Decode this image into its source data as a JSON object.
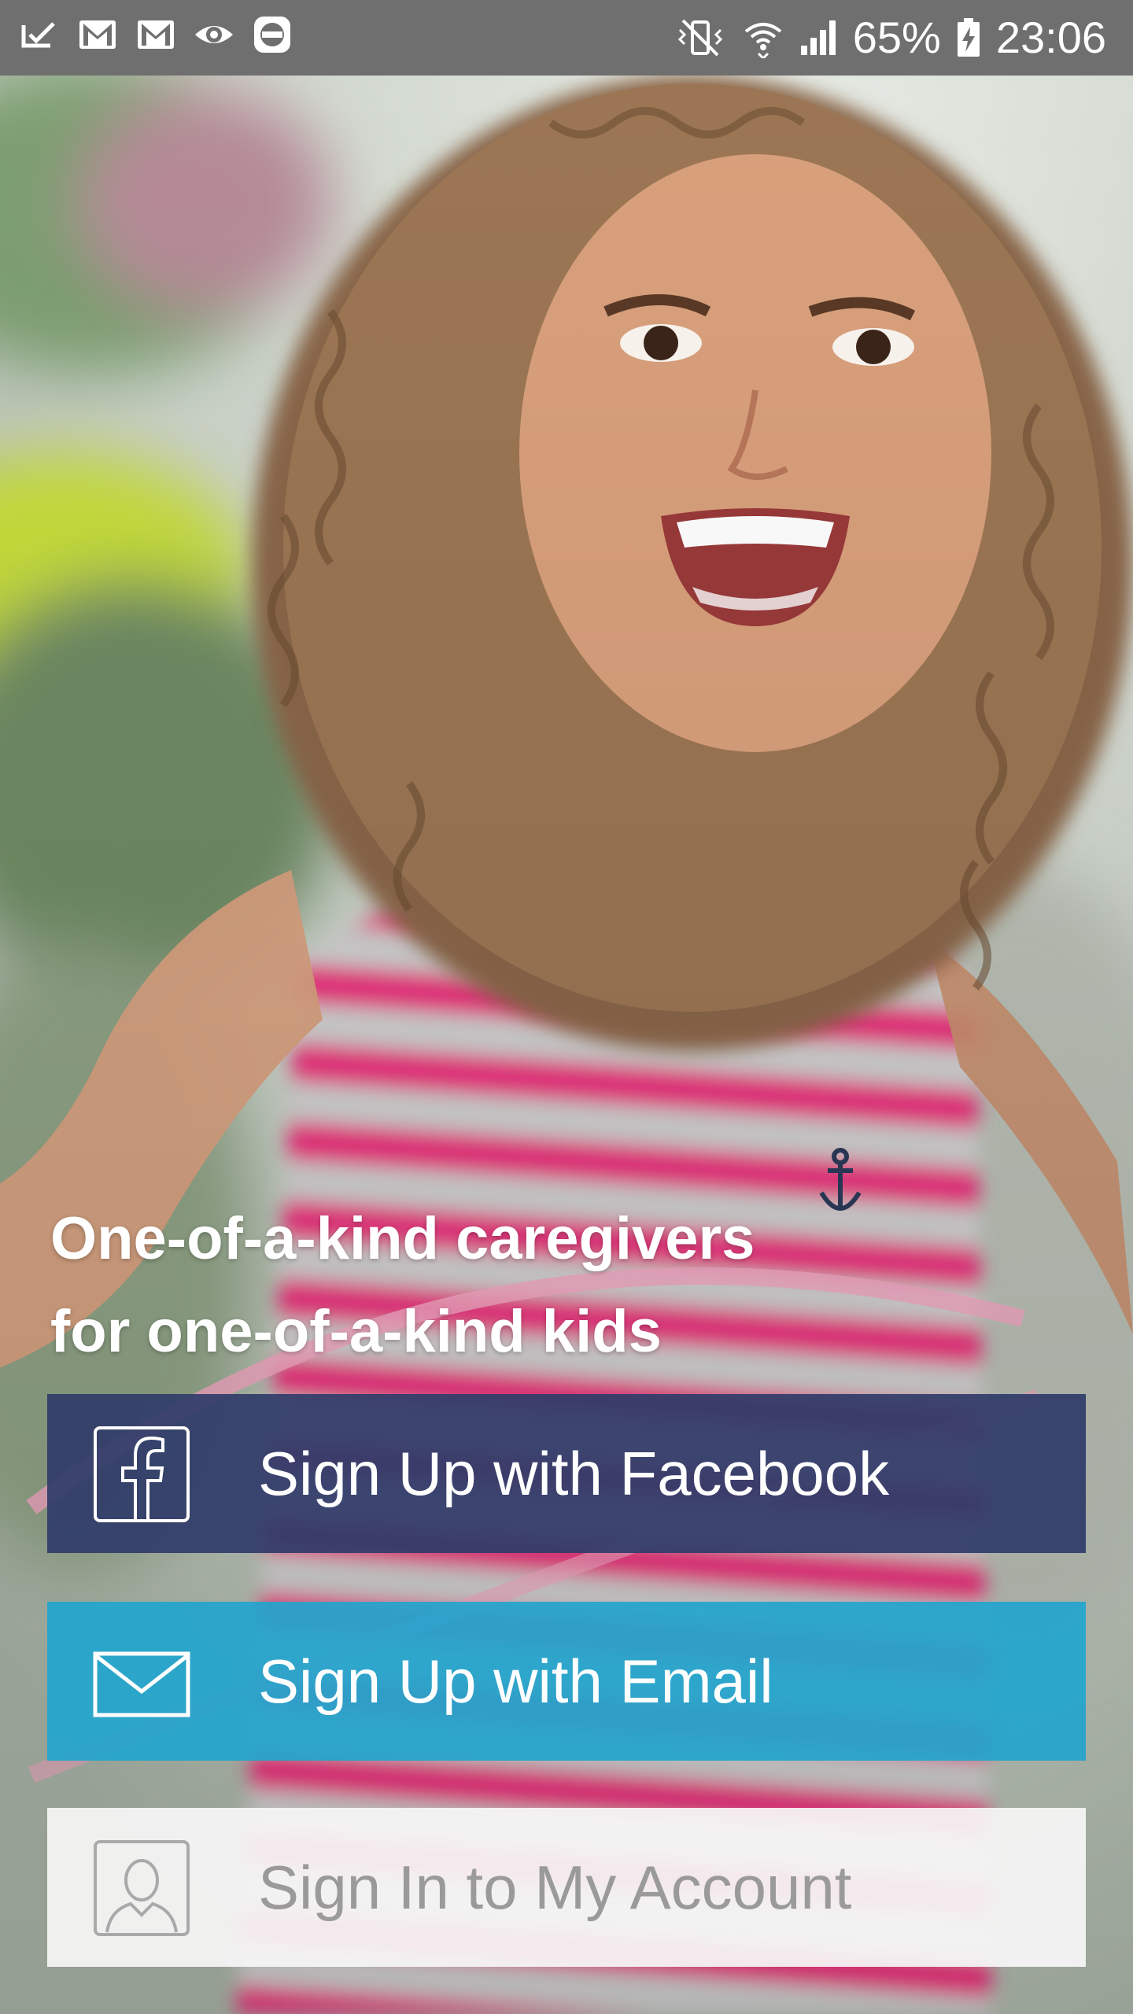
{
  "status_bar": {
    "battery_percent": "65%",
    "time": "23:06",
    "left_icons": [
      "download-done-icon",
      "gmail-icon",
      "gmail-icon",
      "eye-icon",
      "vpn-icon"
    ],
    "right_icons": [
      "vibrate-mute-icon",
      "wifi-icon",
      "signal-icon",
      "battery-charging-icon"
    ]
  },
  "hero": {
    "headline_line1": "One-of-a-kind caregivers",
    "headline_line2": "for one-of-a-kind kids"
  },
  "buttons": {
    "facebook": {
      "label": "Sign Up with Facebook",
      "icon": "facebook-icon",
      "color": "#303c69"
    },
    "email": {
      "label": "Sign Up with Email",
      "icon": "mail-icon",
      "color": "#23a5cd"
    },
    "signin": {
      "label": "Sign In to My Account",
      "icon": "user-icon",
      "color": "#f6f6f6"
    }
  }
}
